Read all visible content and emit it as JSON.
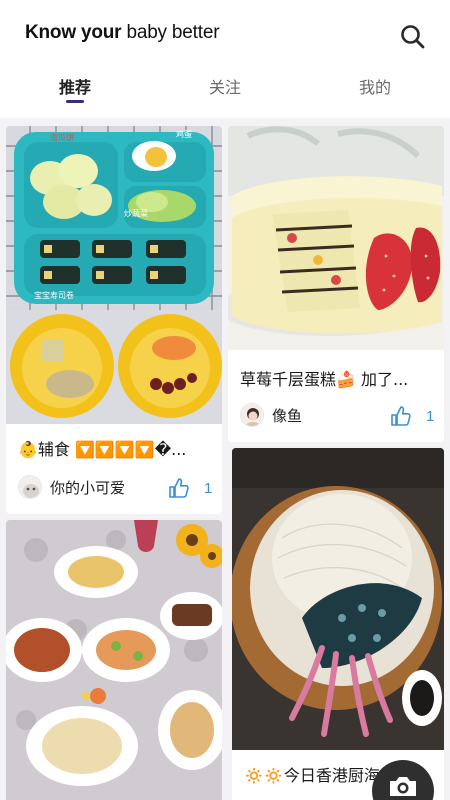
{
  "header": {
    "title_bold": "Know your",
    "title_light": " baby better",
    "search_icon": "search-icon"
  },
  "tabs": [
    {
      "label": "推荐",
      "active": true
    },
    {
      "label": "关注",
      "active": false
    },
    {
      "label": "我的",
      "active": false
    }
  ],
  "feed": [
    {
      "caption": "👶辅食 🔽🔽🔽🔽�...",
      "author": "你的小可爱",
      "likes": "1"
    },
    {
      "caption": "草莓千层蛋糕🍰 加了...",
      "author": "像鱼",
      "likes": "1"
    },
    {
      "caption": "",
      "author": "",
      "likes": ""
    },
    {
      "caption": "🔅🔅今日香港厨海鲜...",
      "author": "",
      "likes": ""
    }
  ],
  "image_text": {
    "melon": "南瓜饼",
    "egg": "鸡蛋",
    "veg": "炒蔬菜",
    "roll": "宝宝寿司卷"
  },
  "colors": {
    "accent": "#3a2e7a",
    "like_blue": "#3c8fd6",
    "background": "#f3f3f5"
  }
}
